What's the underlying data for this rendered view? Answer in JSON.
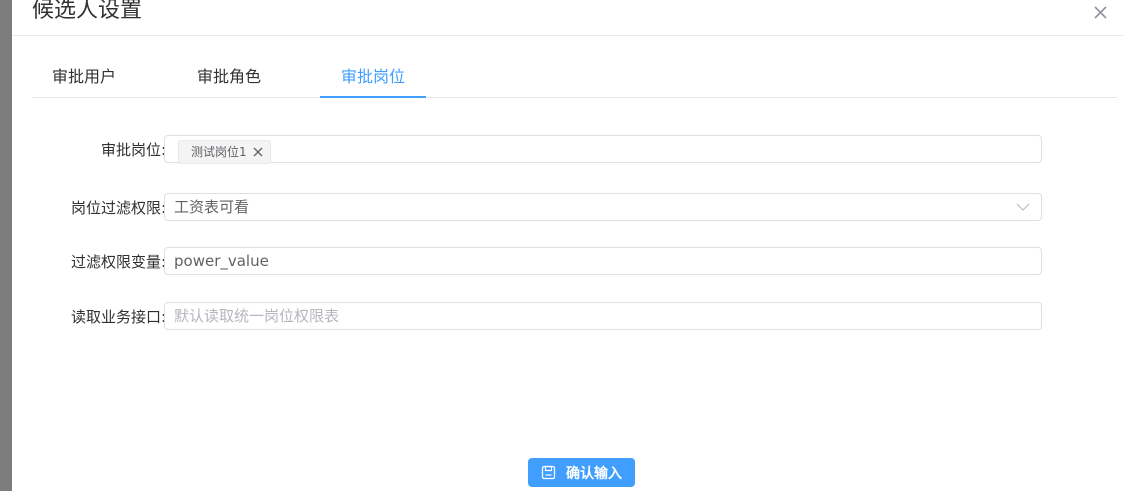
{
  "dialog": {
    "title": "候选人设置"
  },
  "tabs": [
    {
      "label": "审批用户",
      "active": false
    },
    {
      "label": "审批角色",
      "active": false
    },
    {
      "label": "审批岗位",
      "active": true
    }
  ],
  "form": {
    "approval_post": {
      "label": "审批岗位:",
      "tags": [
        "测试岗位1"
      ]
    },
    "post_filter_permission": {
      "label": "岗位过滤权限:",
      "value": "工资表可看"
    },
    "filter_permission_variable": {
      "label": "过滤权限变量:",
      "value": "power_value"
    },
    "read_business_interface": {
      "label": "读取业务接口:",
      "placeholder": "默认读取统一岗位权限表"
    }
  },
  "footer": {
    "confirm_label": "确认输入"
  },
  "colors": {
    "accent": "#409eff",
    "backdrop": "#7d7d7d"
  },
  "icons": {
    "close": "close-icon",
    "tag_close": "close-icon",
    "dropdown": "chevron-down-icon",
    "confirm": "save-icon"
  }
}
